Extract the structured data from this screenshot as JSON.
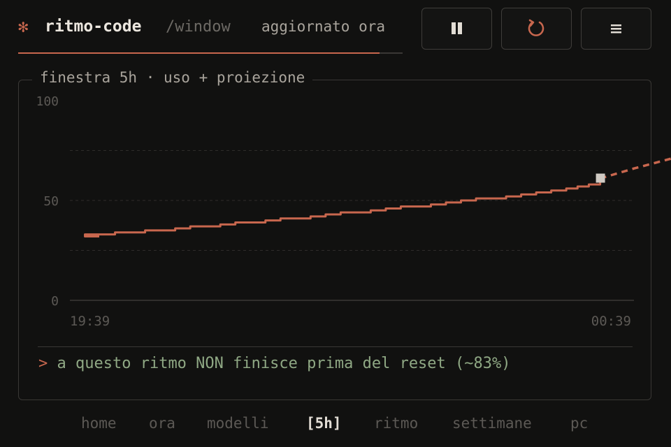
{
  "header": {
    "logo_glyph": "✻",
    "app_name": "ritmo-code",
    "path": "/window",
    "status": "aggiornato ora",
    "progress": 0.94
  },
  "toolbar": {
    "pause_icon": "pause-icon",
    "refresh_icon": "refresh-icon",
    "menu_icon": "menu-icon"
  },
  "panel": {
    "title": "finestra 5h · uso + proiezione",
    "verdict_prompt": ">",
    "verdict_text": "a questo ritmo NON finisce prima del reset (~83%)"
  },
  "chart_data": {
    "type": "line",
    "title": "",
    "xlabel": "",
    "ylabel": "",
    "ylim": [
      0,
      100
    ],
    "yticks": [
      "100",
      "50",
      "0"
    ],
    "gridlines": [
      25,
      50,
      75
    ],
    "x_tick_labels": [
      "19:39",
      "00:39"
    ],
    "xlim_minutes": [
      0,
      300
    ],
    "series": [
      {
        "style": "solid",
        "x": [
          0,
          8,
          16,
          24,
          32,
          40,
          48,
          56,
          64,
          72,
          80,
          88,
          96,
          104,
          112,
          120,
          128,
          136,
          144,
          152,
          160,
          168,
          176,
          184,
          192,
          200,
          208,
          216,
          224,
          232,
          240,
          248,
          256,
          264,
          270,
          276,
          282
        ],
        "y": [
          32,
          33,
          33,
          34,
          34,
          35,
          35,
          36,
          37,
          37,
          38,
          39,
          39,
          40,
          41,
          41,
          42,
          43,
          44,
          44,
          45,
          46,
          47,
          47,
          48,
          49,
          50,
          51,
          51,
          52,
          53,
          54,
          55,
          56,
          57,
          58,
          61
        ]
      },
      {
        "style": "dashed",
        "x": [
          282,
          300,
          320,
          340,
          360
        ],
        "y": [
          61,
          66,
          71,
          76,
          83
        ]
      }
    ],
    "current_marker": {
      "x": 282,
      "y": 61
    },
    "colors": {
      "line": "#c8674e",
      "marker": "#cfcac3",
      "grid": "#2e2c2a",
      "axis": "#3a3835",
      "tick": "#5c5955"
    }
  },
  "nav": {
    "items": [
      "home",
      "ora",
      "modelli",
      "[5h]",
      "ritmo",
      "settimane",
      "pc"
    ],
    "active_index": 3
  }
}
